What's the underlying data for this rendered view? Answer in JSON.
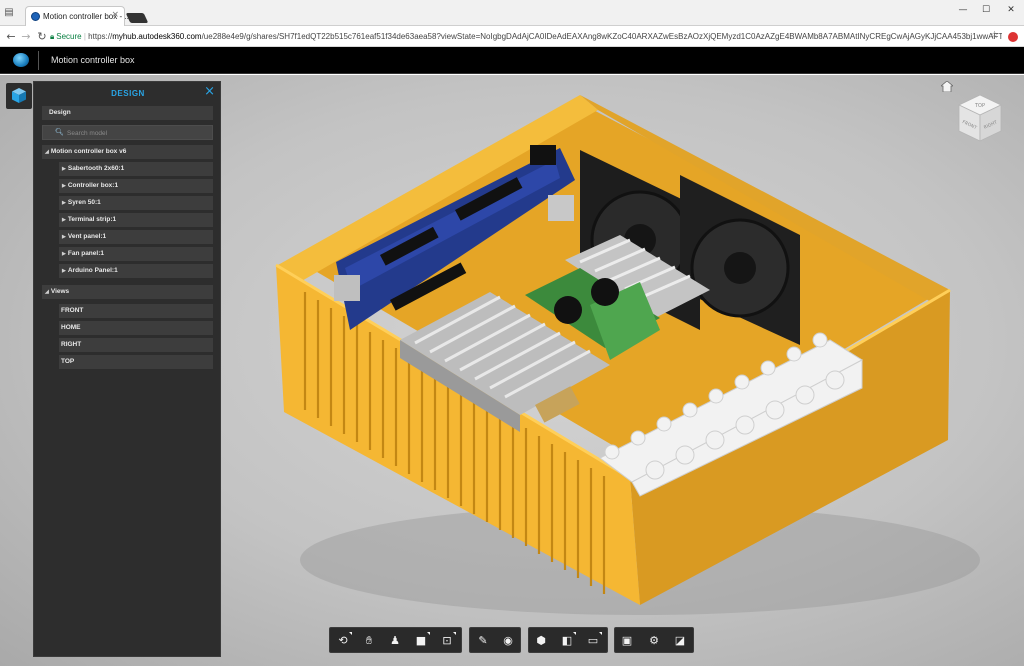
{
  "browser": {
    "tab_title": "Motion controller box - ...",
    "tab_close": "×",
    "url_secure_label": "Secure",
    "url_scheme": "https://",
    "url_host": "myhub.autodesk360.com",
    "url_path": "/ue288e4e9/g/shares/SH7f1edQT22b515c761eaf51f34de63aea58?viewState=NoIgbgDAdAjCA0IDeAdEAXAng8wKZoC40ARXAZwEsBzAOzXjQEMyzd1C0AzAZgE4BWAMb8A7ABMAtINyCREgCwAjAGyKJjCAA453bj1wwAFTlcW9NjNAF8QA..."
  },
  "app": {
    "title": "Motion controller box"
  },
  "panel": {
    "title": "DESIGN",
    "close_label": "×",
    "section_design": "Design",
    "search_placeholder": "Search model",
    "root_item": "Motion controller box v6",
    "components": [
      "Sabertooth 2x60:1",
      "Controller box:1",
      "Syren 50:1",
      "Terminal strip:1",
      "Vent panel:1",
      "Fan panel:1",
      "Arduino Panel:1"
    ],
    "views_label": "Views",
    "views": [
      "FRONT",
      "HOME",
      "RIGHT",
      "TOP"
    ]
  },
  "viewcube": {
    "top": "TOP",
    "front": "FRONT",
    "right": "RIGHT"
  },
  "colors": {
    "accent": "#29a5e6",
    "panel_bg": "#2d2d2d",
    "enclosure": "#f2b835"
  },
  "toolbar_icons": [
    [
      "orbit-icon",
      "pan-icon",
      "walk-icon",
      "camera-icon",
      "fit-icon"
    ],
    [
      "markup-icon",
      "visibility-icon"
    ],
    [
      "explode-icon",
      "section-icon",
      "measure-icon"
    ],
    [
      "model-browser-icon",
      "settings-icon",
      "fullscreen-icon"
    ]
  ]
}
